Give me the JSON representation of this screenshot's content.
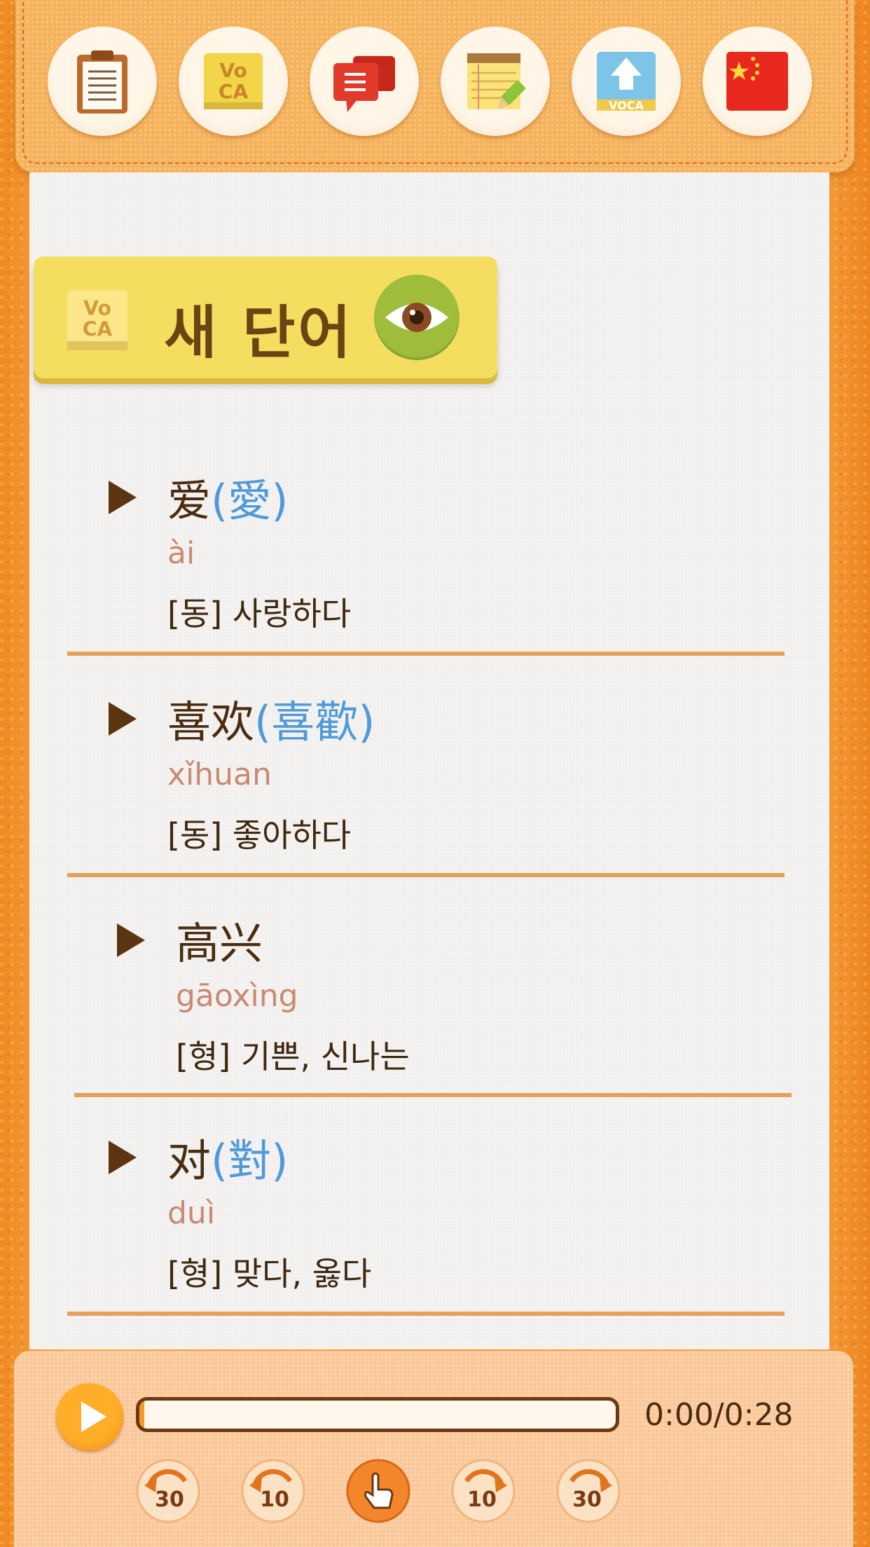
{
  "toolbar": {
    "buttons": [
      {
        "name": "clipboard-button",
        "icon": "clipboard-icon"
      },
      {
        "name": "voca-button",
        "icon": "voca-icon",
        "label_top": "Vo",
        "label_bottom": "CA"
      },
      {
        "name": "chat-button",
        "icon": "speech-bubble-icon"
      },
      {
        "name": "notepad-button",
        "icon": "notepad-pencil-icon"
      },
      {
        "name": "voca-upload-button",
        "icon": "voca-upload-icon",
        "label": "VOCA"
      },
      {
        "name": "china-flag-button",
        "icon": "china-flag-icon"
      }
    ]
  },
  "section": {
    "title": "새 단어",
    "voca_top": "Vo",
    "voca_bottom": "CA"
  },
  "words": [
    {
      "hanzi": "爱",
      "trad": "(愛)",
      "pinyin": "ài",
      "meaning": "[동] 사랑하다"
    },
    {
      "hanzi": "喜欢",
      "trad": "(喜歡)",
      "pinyin": "xǐhuan",
      "meaning": "[동] 좋아하다"
    },
    {
      "hanzi": "高兴",
      "trad": "",
      "pinyin": "gāoxìng",
      "meaning": "[형] 기쁜, 신나는"
    },
    {
      "hanzi": "对",
      "trad": "(對)",
      "pinyin": "duì",
      "meaning": "[형] 맞다, 옳다"
    }
  ],
  "player": {
    "time": "0:00/0:28",
    "progress": 0.0,
    "seek_buttons": [
      "30",
      "10",
      "10",
      "30"
    ]
  },
  "colors": {
    "accent_orange": "#f59a2a",
    "brown_text": "#4a2c10",
    "trad_blue": "#4f9ad8",
    "pinyin_rose": "#c88a72"
  }
}
